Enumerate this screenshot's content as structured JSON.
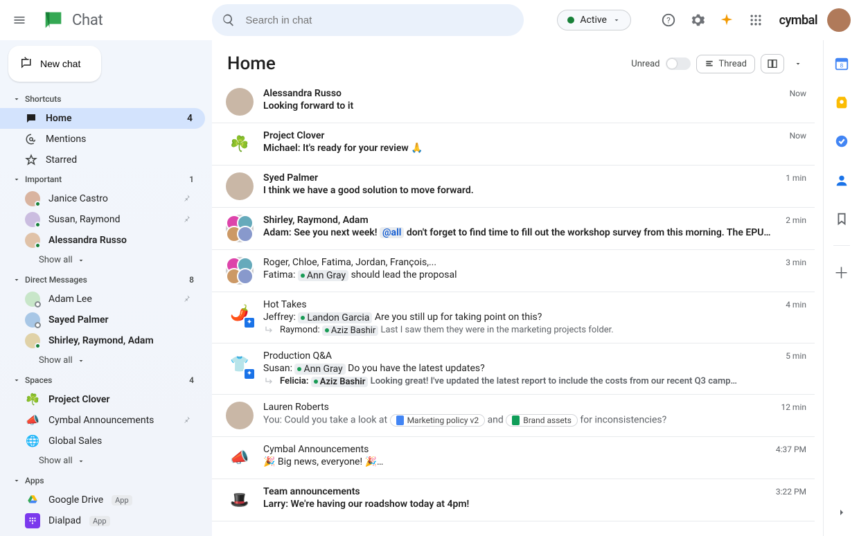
{
  "topbar": {
    "app_name": "Chat",
    "search_placeholder": "Search in chat",
    "status_label": "Active",
    "org_logo_text": "cymbal"
  },
  "new_chat_label": "New chat",
  "sections": {
    "shortcuts": {
      "label": "Shortcuts",
      "items": [
        {
          "icon": "chat",
          "label": "Home",
          "count": "4",
          "selected": true
        },
        {
          "icon": "mention",
          "label": "Mentions",
          "count": "",
          "selected": false
        },
        {
          "icon": "star",
          "label": "Starred",
          "count": "",
          "selected": false
        }
      ]
    },
    "important": {
      "label": "Important",
      "count": "1",
      "items": [
        {
          "name": "Janice Castro",
          "pinned": true,
          "bold": false,
          "presence": "active"
        },
        {
          "name": "Susan, Raymond",
          "pinned": true,
          "bold": false,
          "presence": "active",
          "group": true
        },
        {
          "name": "Alessandra Russo",
          "pinned": false,
          "bold": true,
          "presence": "active"
        }
      ],
      "show_all": "Show all"
    },
    "direct_messages": {
      "label": "Direct Messages",
      "count": "8",
      "items": [
        {
          "name": "Adam Lee",
          "pinned": true,
          "bold": false,
          "presence": "away"
        },
        {
          "name": "Sayed Palmer",
          "pinned": false,
          "bold": true,
          "presence": "away"
        },
        {
          "name": "Shirley, Raymond, Adam",
          "pinned": false,
          "bold": true,
          "presence": "active",
          "group": true
        }
      ],
      "show_all": "Show all"
    },
    "spaces": {
      "label": "Spaces",
      "count": "4",
      "items": [
        {
          "emoji": "☘️",
          "name": "Project Clover",
          "bold": true,
          "pinned": false,
          "unread": true
        },
        {
          "emoji": "📣",
          "name": "Cymbal Announcements",
          "bold": false,
          "pinned": true,
          "unread": false
        },
        {
          "emoji": "🌐",
          "name": "Global Sales",
          "bold": false,
          "pinned": false,
          "unread": false
        }
      ],
      "show_all": "Show all"
    },
    "apps": {
      "label": "Apps",
      "items": [
        {
          "icon": "drive",
          "name": "Google Drive",
          "badge": "App",
          "bg": "#fff"
        },
        {
          "icon": "dialpad",
          "name": "Dialpad",
          "badge": "App",
          "bg": "#7b39ed"
        }
      ]
    }
  },
  "main": {
    "title": "Home",
    "unread_label": "Unread",
    "thread_chip": "Thread"
  },
  "conversations": [
    {
      "name": "Alessandra Russo",
      "bold": true,
      "time": "Now",
      "avatar": "single",
      "lines": [
        {
          "type": "plain",
          "bold": true,
          "text": "Looking forward to it"
        }
      ]
    },
    {
      "name": "Project Clover",
      "bold": true,
      "time": "Now",
      "avatar": "emoji",
      "emoji": "☘️",
      "lines": [
        {
          "type": "plain",
          "bold": true,
          "prefix": "Michael:",
          "text": "It's ready for your review 🙏"
        }
      ]
    },
    {
      "name": "Syed Palmer",
      "bold": true,
      "time": "1 min",
      "avatar": "single",
      "lines": [
        {
          "type": "plain",
          "bold": true,
          "text": "I think we have a good solution to move forward."
        }
      ]
    },
    {
      "name": "Shirley, Raymond, Adam",
      "bold": true,
      "time": "2 min",
      "avatar": "stack",
      "lines": [
        {
          "type": "rich",
          "bold": true,
          "prefix": "Adam:",
          "segments": [
            {
              "text": "See you next week! "
            },
            {
              "mention_all": "@all"
            },
            {
              "text": "  don't forget to find time to fill out the workshop survey from this morning. The EPU…"
            }
          ]
        }
      ]
    },
    {
      "name": "Roger, Chloe, Fatima, Jordan, François,...",
      "bold": false,
      "time": "3 min",
      "avatar": "stack",
      "lines": [
        {
          "type": "rich",
          "prefix": "Fatima:",
          "segments": [
            {
              "mention": "Ann Gray"
            },
            {
              "text": " should lead the proposal"
            }
          ]
        }
      ]
    },
    {
      "name": "Hot Takes",
      "bold": false,
      "time": "4 min",
      "avatar": "emoji",
      "emoji": "🌶️",
      "robot": true,
      "lines": [
        {
          "type": "rich",
          "prefix": "Jeffrey:",
          "segments": [
            {
              "mention": "Landon Garcia"
            },
            {
              "text": " Are you still up for taking point on this?"
            }
          ]
        },
        {
          "type": "reply",
          "prefix": "Raymond:",
          "segments": [
            {
              "mention": "Aziz Bashir"
            },
            {
              "text": " Last I saw them they were in the marketing projects folder."
            }
          ]
        }
      ]
    },
    {
      "name": "Production Q&A",
      "bold": false,
      "time": "5 min",
      "avatar": "emoji",
      "emoji": "👕",
      "robot": true,
      "lines": [
        {
          "type": "rich",
          "prefix": "Susan:",
          "segments": [
            {
              "mention": "Ann Gray"
            },
            {
              "text": " Do you have the latest updates?"
            }
          ]
        },
        {
          "type": "reply",
          "bold": true,
          "prefix": "Felicia:",
          "segments": [
            {
              "mention": "Aziz Bashir"
            },
            {
              "text": " Looking great! I've updated the latest report to include the costs from our recent Q3 camp…"
            }
          ]
        }
      ]
    },
    {
      "name": "Lauren Roberts",
      "bold": false,
      "time": "12 min",
      "avatar": "single",
      "lines": [
        {
          "type": "docs",
          "prefix": "You:",
          "pre_text": "Could you take a look at",
          "docs": [
            {
              "kind": "blue",
              "label": "Marketing policy v2"
            }
          ],
          "mid_text": "and",
          "docs2": [
            {
              "kind": "green",
              "label": "Brand assets"
            }
          ],
          "post_text": "for inconsistencies?"
        }
      ]
    },
    {
      "name": "Cymbal Announcements",
      "bold": false,
      "time": "4:37 PM",
      "avatar": "emoji",
      "emoji": "📣",
      "lines": [
        {
          "type": "plain",
          "text": "🎉 Big news, everyone! 🎉…"
        }
      ]
    },
    {
      "name": "Team announcements",
      "bold": true,
      "time": "3:22 PM",
      "avatar": "emoji",
      "emoji": "🎩",
      "lines": [
        {
          "type": "plain",
          "bold": true,
          "prefix": "Larry:",
          "text": "We're having our roadshow today at 4pm!"
        }
      ]
    }
  ],
  "side_apps": [
    {
      "name": "calendar",
      "color": "#4285f4"
    },
    {
      "name": "keep",
      "color": "#fbbc04"
    },
    {
      "name": "tasks",
      "color": "#4285f4"
    },
    {
      "name": "contacts",
      "color": "#1a73e8"
    },
    {
      "name": "maps",
      "color": "#ea4335"
    }
  ]
}
